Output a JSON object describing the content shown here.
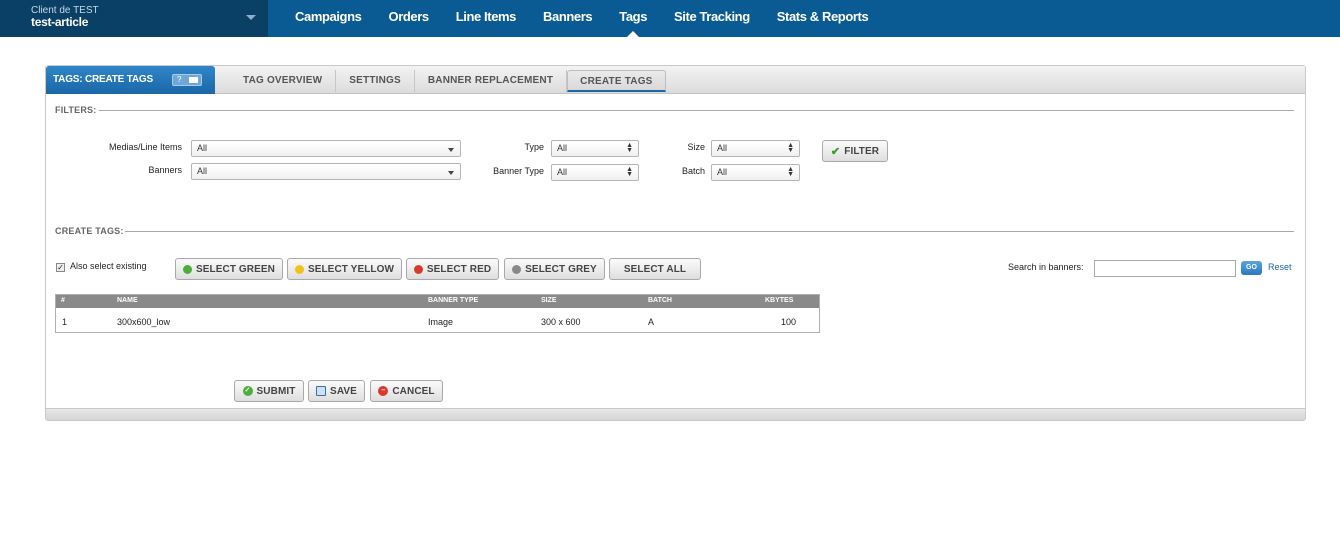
{
  "client": {
    "label": "Client de TEST",
    "name": "test-article"
  },
  "nav": {
    "items": [
      "Campaigns",
      "Orders",
      "Line Items",
      "Banners",
      "Tags",
      "Site Tracking",
      "Stats & Reports"
    ],
    "active": "Tags"
  },
  "panel": {
    "title": "TAGS: CREATE TAGS",
    "help": "?",
    "tabs": [
      "TAG OVERVIEW",
      "SETTINGS",
      "BANNER REPLACEMENT",
      "CREATE TAGS"
    ],
    "active_tab": "CREATE TAGS"
  },
  "filters": {
    "label": "FILTERS:",
    "medias_label": "Medias/Line Items",
    "medias_value": "All",
    "banners_label": "Banners",
    "banners_value": "All",
    "type_label": "Type",
    "type_value": "All",
    "banner_type_label": "Banner Type",
    "banner_type_value": "All",
    "size_label": "Size",
    "size_value": "All",
    "batch_label": "Batch",
    "batch_value": "All",
    "filter_button": "FILTER"
  },
  "create": {
    "label": "CREATE TAGS:",
    "also_select_label": "Also select existing",
    "also_select_checked": true,
    "buttons": {
      "green": "SELECT GREEN",
      "yellow": "SELECT YELLOW",
      "red": "SELECT RED",
      "grey": "SELECT GREY",
      "all": "SELECT ALL"
    },
    "search_label": "Search in banners:",
    "search_value": "",
    "go": "GO",
    "reset": "Reset"
  },
  "table": {
    "headers": {
      "num": "#",
      "name": "NAME",
      "banner_type": "BANNER TYPE",
      "size": "SIZE",
      "batch": "BATCH",
      "kbytes": "KBYTES"
    },
    "rows": [
      {
        "num": "1",
        "name": "300x600_low",
        "banner_type": "Image",
        "size": "300 x 600",
        "batch": "A",
        "kbytes": "100"
      }
    ]
  },
  "actions": {
    "submit": "SUBMIT",
    "save": "SAVE",
    "cancel": "CANCEL"
  },
  "colors": {
    "topbar": "#0a5a93",
    "client_bg": "#0a3f66",
    "accent": "#1a67a7",
    "green": "#4caf3a",
    "yellow": "#f2c21b",
    "red": "#d83a2e",
    "grey": "#888888"
  }
}
